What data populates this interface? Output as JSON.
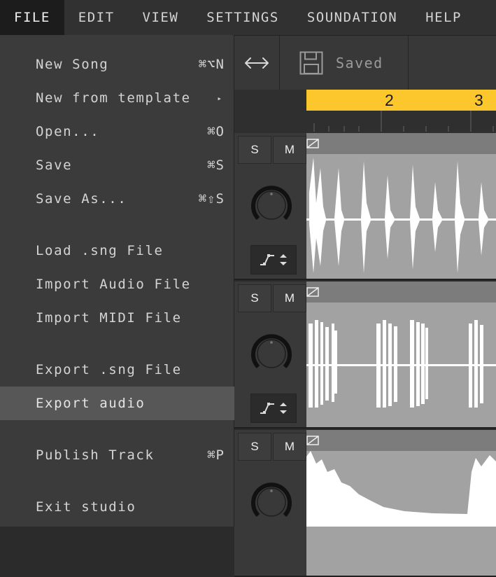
{
  "menubar": {
    "items": [
      {
        "label": "FILE",
        "active": true
      },
      {
        "label": "EDIT"
      },
      {
        "label": "VIEW"
      },
      {
        "label": "SETTINGS"
      },
      {
        "label": "SOUNDATION"
      },
      {
        "label": "HELP"
      }
    ]
  },
  "toolbar": {
    "fit_icon": "horizontal-arrows-icon",
    "save_status": "Saved",
    "save_icon": "floppy-disk-icon"
  },
  "file_menu": {
    "items": [
      {
        "label": "New Song",
        "shortcut": "⌘⌥N"
      },
      {
        "label": "New from template",
        "submenu_icon": "▸"
      },
      {
        "label": "Open...",
        "shortcut": "⌘O"
      },
      {
        "label": "Save",
        "shortcut": "⌘S"
      },
      {
        "label": "Save As...",
        "shortcut": "⌘⇧S"
      },
      {
        "label": "Load .sng File"
      },
      {
        "label": "Import Audio File"
      },
      {
        "label": "Import MIDI File"
      },
      {
        "label": "Export .sng File"
      },
      {
        "label": "Export audio",
        "highlighted": true
      },
      {
        "label": "Publish Track",
        "shortcut": "⌘P"
      },
      {
        "label": "Exit studio"
      }
    ]
  },
  "timeline": {
    "bar_numbers": [
      "2",
      "3"
    ],
    "loop_color": "#fcc72d"
  },
  "tracks": [
    {
      "solo_label": "S",
      "mute_label": "M"
    },
    {
      "solo_label": "S",
      "mute_label": "M"
    },
    {
      "solo_label": "S",
      "mute_label": "M"
    }
  ]
}
